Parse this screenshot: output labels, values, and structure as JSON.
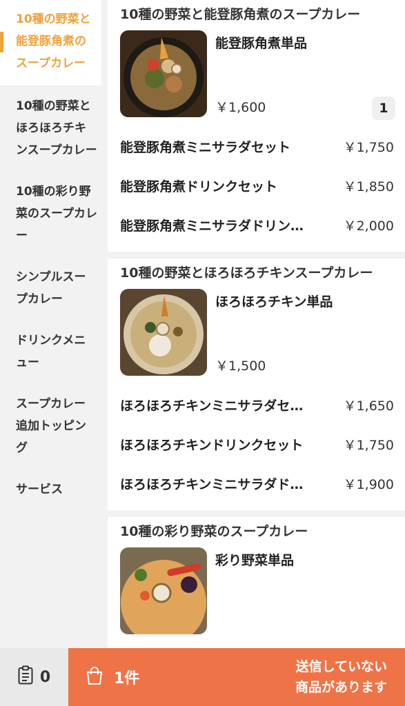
{
  "sidebar": {
    "items": [
      {
        "label": "10種の野菜と能登豚角煮のスープカレー",
        "active": true
      },
      {
        "label": "10種の野菜とほろほろチキンスープカレー",
        "active": false
      },
      {
        "label": "10種の彩り野菜のスープカレー",
        "active": false
      },
      {
        "label": "シンプルスープカレー",
        "active": false
      },
      {
        "label": "ドリンクメニュー",
        "active": false
      },
      {
        "label": "スープカレー追加トッピング",
        "active": false
      },
      {
        "label": "サービス",
        "active": false
      }
    ]
  },
  "sections": [
    {
      "title": "10種の野菜と能登豚角煮のスープカレー",
      "single": {
        "name": "能登豚角煮単品",
        "price": "￥1,600",
        "qty": "1",
        "image": "pork-curry-photo"
      },
      "sets": [
        {
          "name": "能登豚角煮ミニサラダセット",
          "price": "￥1,750"
        },
        {
          "name": "能登豚角煮ドリンクセット",
          "price": "￥1,850"
        },
        {
          "name": "能登豚角煮ミニサラダドリン…",
          "price": "￥2,000"
        }
      ]
    },
    {
      "title": "10種の野菜とほろほろチキンスープカレー",
      "single": {
        "name": "ほろほろチキン単品",
        "price": "￥1,500",
        "qty": "",
        "image": "chicken-curry-photo"
      },
      "sets": [
        {
          "name": "ほろほろチキンミニサラダセ…",
          "price": "￥1,650"
        },
        {
          "name": "ほろほろチキンドリンクセット",
          "price": "￥1,750"
        },
        {
          "name": "ほろほろチキンミニサラダド…",
          "price": "￥1,900"
        }
      ]
    },
    {
      "title": "10種の彩り野菜のスープカレー",
      "single": {
        "name": "彩り野菜単品",
        "price": "",
        "qty": "",
        "image": "vegetable-curry-photo"
      },
      "sets": []
    }
  ],
  "bottom": {
    "order_count": "0",
    "order_icon": "clipboard-icon",
    "cart_icon": "shopping-bag-icon",
    "cart_count": "1件",
    "notice_line1": "送信していない",
    "notice_line2": "商品があります"
  },
  "colors": {
    "accent": "#f0a23c",
    "cart": "#ee7448"
  }
}
